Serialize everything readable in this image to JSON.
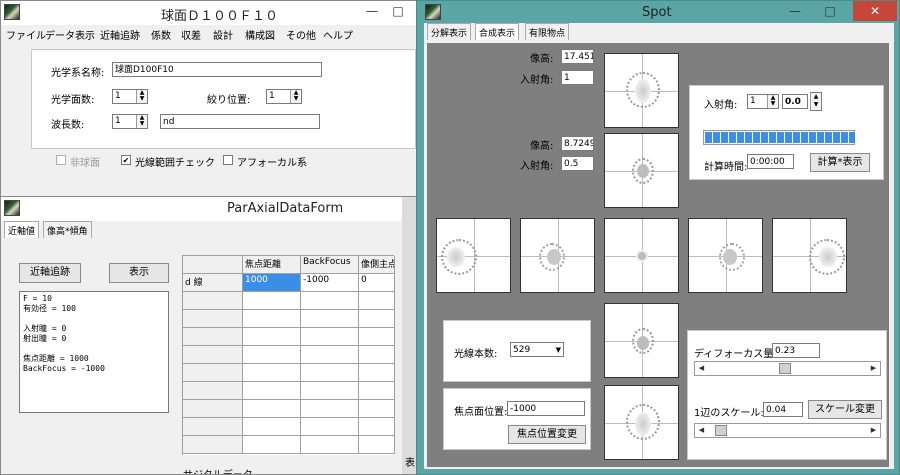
{
  "main_window": {
    "title": "球面Ｄ１００Ｆ１０",
    "menu": [
      "ファイル",
      "データ表示",
      "近軸追跡",
      "係数",
      "収差",
      "設計",
      "構成図",
      "その他",
      "ヘルプ"
    ],
    "form": {
      "system_name_label": "光学系名称:",
      "system_name_value": "球面D100F10",
      "surface_count_label": "光学面数:",
      "surface_count_value": "1",
      "stop_position_label": "絞り位置:",
      "stop_position_value": "1",
      "wavelength_count_label": "波長数:",
      "wavelength_count_value": "1",
      "wavelength_name_value": "nd",
      "aspheric_label": "非球面",
      "ray_check_label": "光線範囲チェック",
      "ray_check_mark": "✔",
      "afocal_label": "アフォーカル系"
    }
  },
  "paraxial_window": {
    "title": "ParAxialDataForm",
    "tabs": [
      "近軸値",
      "像高*傾角"
    ],
    "trace_button": "近軸追跡",
    "show_button": "表示",
    "output_lines": [
      "F = 10",
      "有効径 = 100",
      "",
      "入射瞳 = 0",
      "射出瞳 = 0",
      "",
      "焦点距離   = 1000",
      "BackFocus = -1000"
    ],
    "table": {
      "headers": [
        "焦点距離",
        "BackFocus",
        "像側主点"
      ],
      "row_label": "d 線",
      "values": [
        "1000",
        "-1000",
        "0"
      ]
    },
    "bottom_text": "サジタルデータ",
    "side_text": "表"
  },
  "spot_window": {
    "title": "Spot",
    "tabs": [
      "分解表示",
      "合成表示",
      "有限物点"
    ],
    "image_height_label": "像高:",
    "incident_angle_label": "入射角:",
    "upper": {
      "image_height": "17.451",
      "incident_angle": "1"
    },
    "middle": {
      "image_height": "8.7249",
      "incident_angle": "0.5"
    },
    "calc_panel": {
      "angle_label": "入射角:",
      "angle_int": "1",
      "angle_dec": "0.0",
      "progress": 1.0,
      "time_label": "計算時間:",
      "time_value": "0:00:00",
      "button": "計算*表示"
    },
    "ray_panel": {
      "label": "光線本数:",
      "value": "529"
    },
    "focus_panel": {
      "label": "焦点面位置:",
      "value": "-1000",
      "button": "焦点位置変更"
    },
    "defocus": {
      "label": "ディフォーカス量:",
      "value": "0.23"
    },
    "scale": {
      "label": "1辺のスケール:",
      "value": "0.04",
      "button": "スケール変更"
    }
  },
  "icons": {
    "app": "app-icon",
    "minimize": "minimize-icon",
    "maximize": "maximize-icon",
    "close": "close-icon"
  },
  "colors": {
    "progress": "#3a8ee6",
    "spot_bg": "#7f7f7f",
    "close": "#c7463a",
    "spot_border": "#5aa6a6"
  }
}
